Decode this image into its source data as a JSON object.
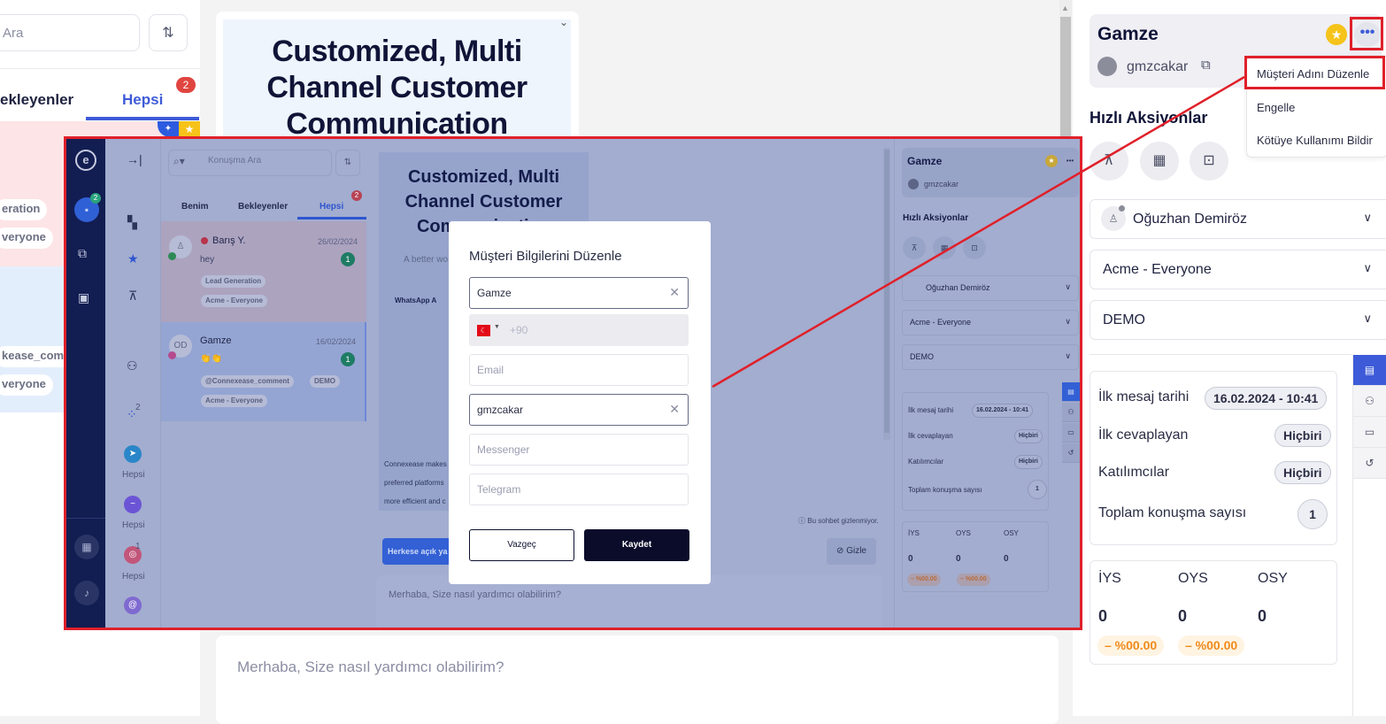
{
  "background": {
    "list": {
      "search_placeholder": "Ara",
      "tabs": [
        {
          "label": "ekleyenler",
          "active": false
        },
        {
          "label": "Hepsi",
          "active": true,
          "badge": "2"
        }
      ],
      "row1_chips": [
        "eration",
        "veryone"
      ],
      "row2_chips": [
        "kease_comr",
        "veryone"
      ]
    },
    "banner_title": "Customized, Multi Channel Customer Communication",
    "composer_placeholder": "Merhaba, Size nasıl yardımcı olabilirim?",
    "contact": {
      "name": "Gamze",
      "handle": "gmzcakar"
    },
    "more_menu": {
      "items": [
        "Müşteri Adını Düzenle",
        "Engelle",
        "Kötüye Kullanımı Bildir"
      ],
      "highlighted_index": 0
    },
    "quick_actions": {
      "title": "Hızlı Aksiyonlar",
      "buttons": [
        "pin-icon",
        "calendar-icon",
        "archive-icon"
      ]
    },
    "selects": [
      {
        "label": "Oğuzhan Demiröz",
        "has_avatar": true
      },
      {
        "label": "Acme - Everyone"
      },
      {
        "label": "DEMO"
      }
    ],
    "info": [
      {
        "label": "İlk mesaj tarihi",
        "value": "16.02.2024 - 10:41"
      },
      {
        "label": "İlk cevaplayan",
        "value": "Hiçbiri"
      },
      {
        "label": "Katılımcılar",
        "value": "Hiçbiri"
      },
      {
        "label": "Toplam konuşma sayısı",
        "value": "1"
      }
    ],
    "stats": [
      {
        "label": "İYS",
        "value": "0",
        "change": "– %00.00"
      },
      {
        "label": "OYS",
        "value": "0",
        "change": "– %00.00"
      },
      {
        "label": "OSY",
        "value": "0"
      }
    ],
    "side_tabs": [
      "document-icon",
      "users-icon",
      "chat-icon",
      "history-icon"
    ]
  },
  "inset": {
    "nav_badge": "2",
    "sub_channels": [
      {
        "name": "telegram",
        "label": "Hepsi"
      },
      {
        "name": "messenger",
        "label": "Hepsi"
      },
      {
        "name": "instagram",
        "label": "Hepsi",
        "badge": "1"
      }
    ],
    "groups_badge": "2",
    "search_placeholder": "Konuşma Ara",
    "tabs": [
      "Benim",
      "Bekleyenler",
      "Hepsi"
    ],
    "tab_badge": "2",
    "conversations": [
      {
        "avatar": "",
        "name": "Barış Y.",
        "date": "26/02/2024",
        "message": "hey",
        "count": "1",
        "chips": [
          "Lead Generation",
          "Acme - Everyone"
        ],
        "channel": "whatsapp"
      },
      {
        "avatar": "OD",
        "name": "Gamze",
        "date": "16/02/2024",
        "message": "👏👏",
        "count": "1",
        "chips": [
          "@Connexease_comment",
          "DEMO",
          "Acme - Everyone"
        ],
        "channel": "instagram"
      }
    ],
    "banner": {
      "title": "Customized, Multi Channel Customer Communication",
      "subtitle": "A better wo",
      "whatsapp": "WhatsApp A",
      "footer": [
        "Connexease makes",
        "preferred platforms",
        "more efficient and c"
      ]
    },
    "hint": "Bu sohbet gizlenmiyor.",
    "public_button": "Herkese açık ya",
    "hide_button": "Gizle",
    "composer_placeholder": "Merhaba, Size nasıl yardımcı olabilirim?",
    "right": {
      "name": "Gamze",
      "handle": "gmzcakar",
      "quick_title": "Hızlı Aksiyonlar",
      "selects": [
        "Oğuzhan Demiröz",
        "Acme - Everyone",
        "DEMO"
      ],
      "info": [
        {
          "label": "İlk mesaj tarihi",
          "value": "16.02.2024 - 10:41"
        },
        {
          "label": "İlk cevaplayan",
          "value": "Hiçbiri"
        },
        {
          "label": "Katılımcılar",
          "value": "Hiçbiri"
        },
        {
          "label": "Toplam konuşma sayısı",
          "value": "1"
        }
      ],
      "stats": [
        {
          "label": "İYS",
          "value": "0",
          "change": "– %00.00"
        },
        {
          "label": "OYS",
          "value": "0",
          "change": "– %00.00"
        },
        {
          "label": "OSY",
          "value": "0"
        }
      ]
    },
    "modal": {
      "title": "Müşteri Bilgilerini Düzenle",
      "name_value": "Gamze",
      "phone_prefix": "+90",
      "email_placeholder": "Email",
      "instagram_value": "gmzcakar",
      "messenger_placeholder": "Messenger",
      "telegram_placeholder": "Telegram",
      "cancel_label": "Vazgeç",
      "save_label": "Kaydet"
    }
  },
  "colors": {
    "accent": "#3d5bd9",
    "highlight_frame": "#e0202a",
    "primary_dark": "#0a0c2a",
    "warning": "#f08a1c"
  }
}
